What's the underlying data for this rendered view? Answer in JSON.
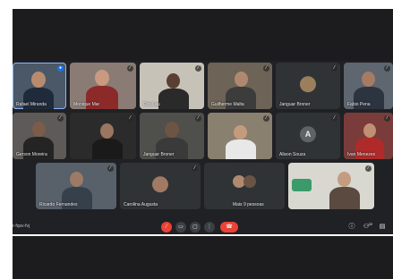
{
  "participants_row1": [
    {
      "name": "Rafael Miranda",
      "mic": "active"
    },
    {
      "name": "Monique Mar",
      "mic": "muted"
    },
    {
      "name": "Cris Lau",
      "mic": "muted"
    },
    {
      "name": "Guilherme Malta",
      "mic": "muted"
    },
    {
      "name": "Janguar Broner",
      "mic": "muted"
    },
    {
      "name": "Fabio Pena",
      "mic": "muted"
    }
  ],
  "participants_row2": [
    {
      "name": "Gerson Moreira",
      "mic": "muted"
    },
    {
      "name": "",
      "mic": "muted"
    },
    {
      "name": "Janguar Broner",
      "mic": "muted"
    },
    {
      "name": "",
      "mic": "muted"
    },
    {
      "name": "Alison Souza",
      "initial": "A",
      "mic": "muted"
    },
    {
      "name": "Ivan Menezes",
      "mic": "muted"
    }
  ],
  "participants_row3": [
    {
      "name": "Ricardo Fernandes",
      "mic": "muted"
    },
    {
      "name": "Carolina Augusta",
      "mic": "muted"
    },
    {
      "name": "Mais 9 pessoas",
      "mic": "none"
    },
    {
      "name": "",
      "mic": "muted"
    }
  ],
  "toolbar": {
    "meeting_code": "r-fqsv-fvj",
    "mic_icon": "mic-off-icon",
    "camera_icon": "camera-icon",
    "present_icon": "present-icon",
    "more_icon": "more-options-icon",
    "hangup_icon": "hang-up-icon",
    "info_icon": "info-icon",
    "people_icon": "people-icon",
    "people_count": "22",
    "chat_icon": "chat-icon"
  },
  "colors": {
    "background": "#202124",
    "tile": "#3c4043",
    "hangup": "#ea4335",
    "accent": "#1a73e8"
  }
}
